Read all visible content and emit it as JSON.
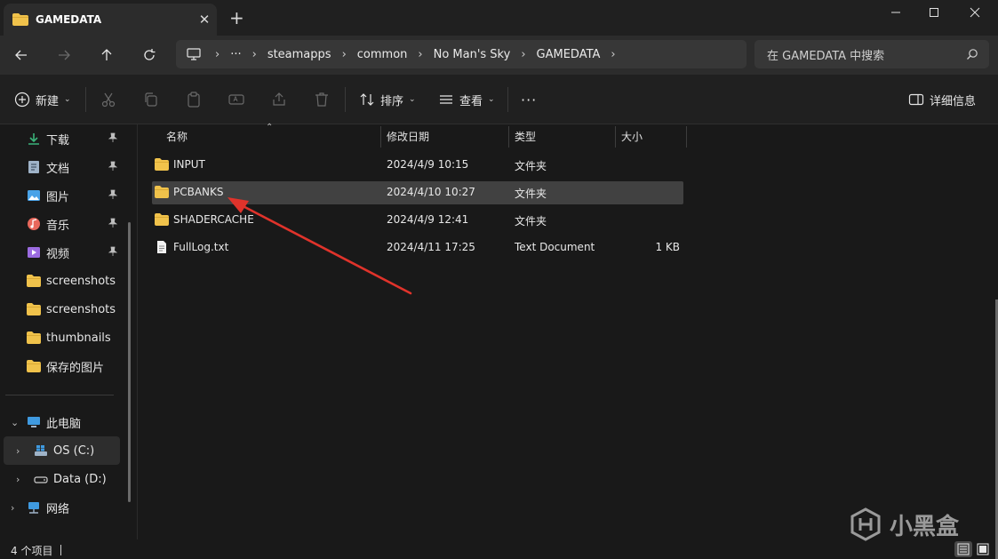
{
  "window": {
    "tab_title": "GAMEDATA",
    "tab_close": "✕",
    "new_tab": "+",
    "min": "—",
    "max": "☐",
    "close": "✕"
  },
  "address": {
    "overflow": "···",
    "crumbs": [
      "steamapps",
      "common",
      "No Man's Sky",
      "GAMEDATA"
    ]
  },
  "search": {
    "placeholder": "在 GAMEDATA 中搜索"
  },
  "commandbar": {
    "new_label": "新建",
    "sort_label": "排序",
    "view_label": "查看",
    "more": "···",
    "details_label": "详细信息"
  },
  "sidebar": {
    "quick": [
      {
        "label": "下载",
        "icon": "download-icon",
        "color": "#3bb37a"
      },
      {
        "label": "文档",
        "icon": "document-icon",
        "color": "#9fb3c8"
      },
      {
        "label": "图片",
        "icon": "pictures-icon",
        "color": "#4aa3e8"
      },
      {
        "label": "音乐",
        "icon": "music-icon",
        "color": "#e8685c"
      },
      {
        "label": "视频",
        "icon": "video-icon",
        "color": "#9b6be0"
      },
      {
        "label": "screenshots",
        "icon": "folder-icon",
        "color": "#f0c24b"
      },
      {
        "label": "screenshots",
        "icon": "folder-icon",
        "color": "#f0c24b"
      },
      {
        "label": "thumbnails",
        "icon": "folder-icon",
        "color": "#f0c24b"
      },
      {
        "label": "保存的图片",
        "icon": "folder-icon",
        "color": "#f0c24b"
      }
    ],
    "this_pc": "此电脑",
    "drive_c": "OS (C:)",
    "drive_d": "Data (D:)",
    "network": "网络"
  },
  "columns": {
    "name": "名称",
    "modified": "修改日期",
    "type": "类型",
    "size": "大小"
  },
  "files": [
    {
      "name": "INPUT",
      "modified": "2024/4/9 10:15",
      "type": "文件夹",
      "size": "",
      "kind": "folder"
    },
    {
      "name": "PCBANKS",
      "modified": "2024/4/10 10:27",
      "type": "文件夹",
      "size": "",
      "kind": "folder"
    },
    {
      "name": "SHADERCACHE",
      "modified": "2024/4/9 12:41",
      "type": "文件夹",
      "size": "",
      "kind": "folder"
    },
    {
      "name": "FullLog.txt",
      "modified": "2024/4/11 17:25",
      "type": "Text Document",
      "size": "1 KB",
      "kind": "text"
    }
  ],
  "status": {
    "count": "4 个项目"
  },
  "watermark": {
    "text": "小黑盒"
  },
  "colors": {
    "accent_arrow": "#e0332b",
    "folder": "#f0c24b"
  }
}
